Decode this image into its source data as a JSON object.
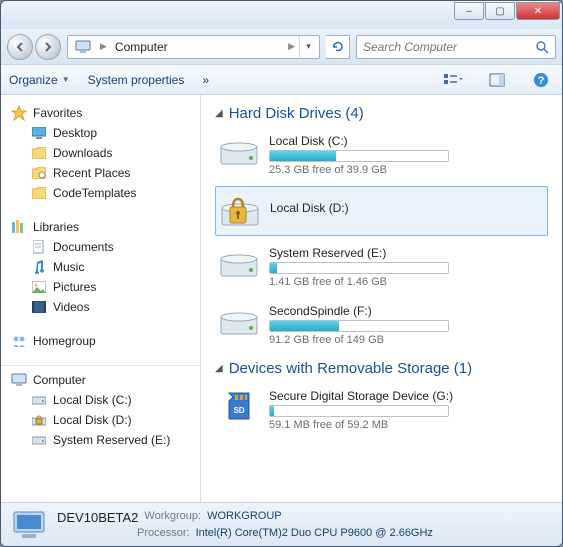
{
  "titlebar": {
    "minimize": "–",
    "maximize": "▢",
    "close": "✕"
  },
  "address": {
    "location": "Computer",
    "search_placeholder": "Search Computer"
  },
  "toolbar": {
    "organize": "Organize",
    "sysprops": "System properties",
    "more": "»"
  },
  "sidebar": {
    "favorites": {
      "label": "Favorites",
      "items": [
        "Desktop",
        "Downloads",
        "Recent Places",
        "CodeTemplates"
      ]
    },
    "libraries": {
      "label": "Libraries",
      "items": [
        "Documents",
        "Music",
        "Pictures",
        "Videos"
      ]
    },
    "homegroup": {
      "label": "Homegroup"
    },
    "computer": {
      "label": "Computer",
      "items": [
        "Local Disk (C:)",
        "Local Disk (D:)",
        "System Reserved (E:)"
      ]
    }
  },
  "content": {
    "hdd": {
      "title": "Hard Disk Drives (4)",
      "drives": [
        {
          "name": "Local Disk (C:)",
          "free": "25.3 GB free of 39.9 GB",
          "fill": 37
        },
        {
          "name": "Local Disk (D:)",
          "locked": true
        },
        {
          "name": "System Reserved (E:)",
          "free": "1.41 GB free of 1.46 GB",
          "fill": 4
        },
        {
          "name": "SecondSpindle (F:)",
          "free": "91.2 GB free of 149 GB",
          "fill": 39
        }
      ]
    },
    "removable": {
      "title": "Devices with Removable Storage (1)",
      "drives": [
        {
          "name": "Secure Digital Storage Device (G:)",
          "free": "59.1 MB free of 59.2 MB",
          "fill": 2
        }
      ]
    }
  },
  "status": {
    "computer_name": "DEV10BETA2",
    "workgroup_label": "Workgroup:",
    "workgroup": "WORKGROUP",
    "processor_label": "Processor:",
    "processor": "Intel(R) Core(TM)2 Duo CPU     P9600  @ 2.66GHz"
  }
}
